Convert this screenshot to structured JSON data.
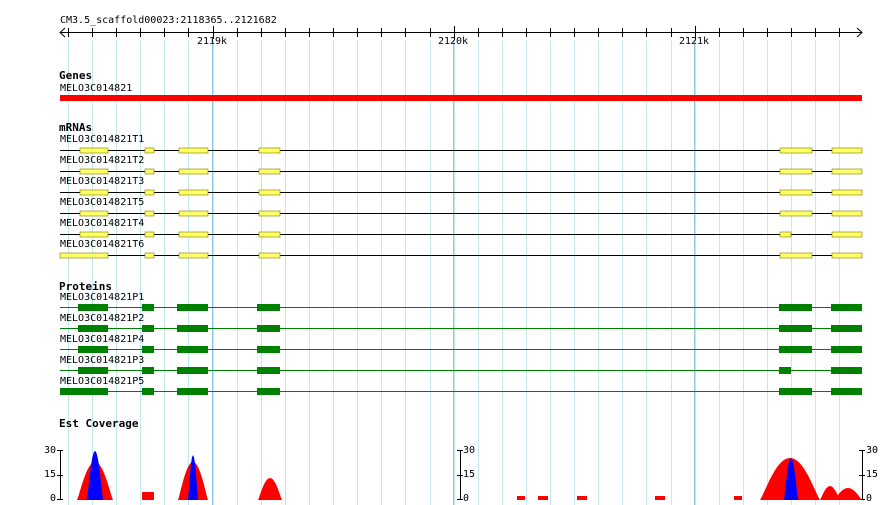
{
  "ruler": {
    "region": "CM3.5_scaffold00023:2118365..2121682",
    "ticks": [
      {
        "label": "2119k",
        "pos": 2119000
      },
      {
        "label": "2120k",
        "pos": 2120000
      },
      {
        "label": "2121k",
        "pos": 2121000
      }
    ]
  },
  "tracks": {
    "genes": {
      "title": "Genes",
      "features": [
        {
          "name": "MELO3C014821",
          "color": "#ff0000"
        }
      ]
    },
    "mrnas": {
      "title": "mRNAs",
      "color": "#ffff66",
      "features": [
        {
          "name": "MELO3C014821T1"
        },
        {
          "name": "MELO3C014821T2"
        },
        {
          "name": "MELO3C014821T3"
        },
        {
          "name": "MELO3C014821T5"
        },
        {
          "name": "MELO3C014821T4"
        },
        {
          "name": "MELO3C014821T6"
        }
      ]
    },
    "proteins": {
      "title": "Proteins",
      "color": "#008000",
      "features": [
        {
          "name": "MELO3C014821P1"
        },
        {
          "name": "MELO3C014821P2"
        },
        {
          "name": "MELO3C014821P4"
        },
        {
          "name": "MELO3C014821P3"
        },
        {
          "name": "MELO3C014821P5"
        }
      ]
    },
    "est_coverage": {
      "title": "Est Coverage",
      "scale_labels": [
        "30",
        "15",
        "0"
      ],
      "colors": {
        "low": "#ff0000",
        "high": "#0000ff"
      }
    }
  }
}
